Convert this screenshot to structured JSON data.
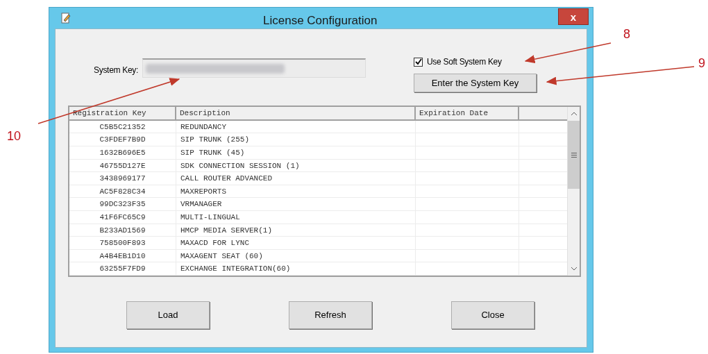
{
  "window": {
    "title": "License Configuration",
    "close": "x"
  },
  "system_key": {
    "label": "System Key:"
  },
  "soft_key": {
    "label": "Use Soft System Key",
    "checked": true
  },
  "enter_button": "Enter the System Key",
  "table": {
    "columns": [
      "Registration Key",
      "Description",
      "Expiration Date"
    ],
    "rows": [
      {
        "key": "C5B5C21352",
        "description": "REDUNDANCY"
      },
      {
        "key": "C3FDEF7B9D",
        "description": "SIP TRUNK (255)"
      },
      {
        "key": "1632B696E5",
        "description": "SIP TRUNK (45)"
      },
      {
        "key": "46755D127E",
        "description": "SDK CONNECTION SESSION (1)"
      },
      {
        "key": "3438969177",
        "description": "CALL ROUTER ADVANCED"
      },
      {
        "key": "AC5F828C34",
        "description": "MAXREPORTS"
      },
      {
        "key": "99DC323F35",
        "description": "VRMANAGER"
      },
      {
        "key": "41F6FC65C9",
        "description": "MULTI-LINGUAL"
      },
      {
        "key": "B233AD1569",
        "description": "HMCP MEDIA SERVER(1)"
      },
      {
        "key": "758500F893",
        "description": "MAXACD FOR LYNC"
      },
      {
        "key": "A4B4EB1D10",
        "description": "MAXAGENT SEAT (60)"
      },
      {
        "key": "63255F7FD9",
        "description": "EXCHANGE INTEGRATION(60)"
      }
    ]
  },
  "buttons": [
    "Load",
    "Refresh",
    "Close"
  ],
  "annotations": [
    {
      "label": "8"
    },
    {
      "label": "9"
    },
    {
      "label": "10"
    }
  ]
}
